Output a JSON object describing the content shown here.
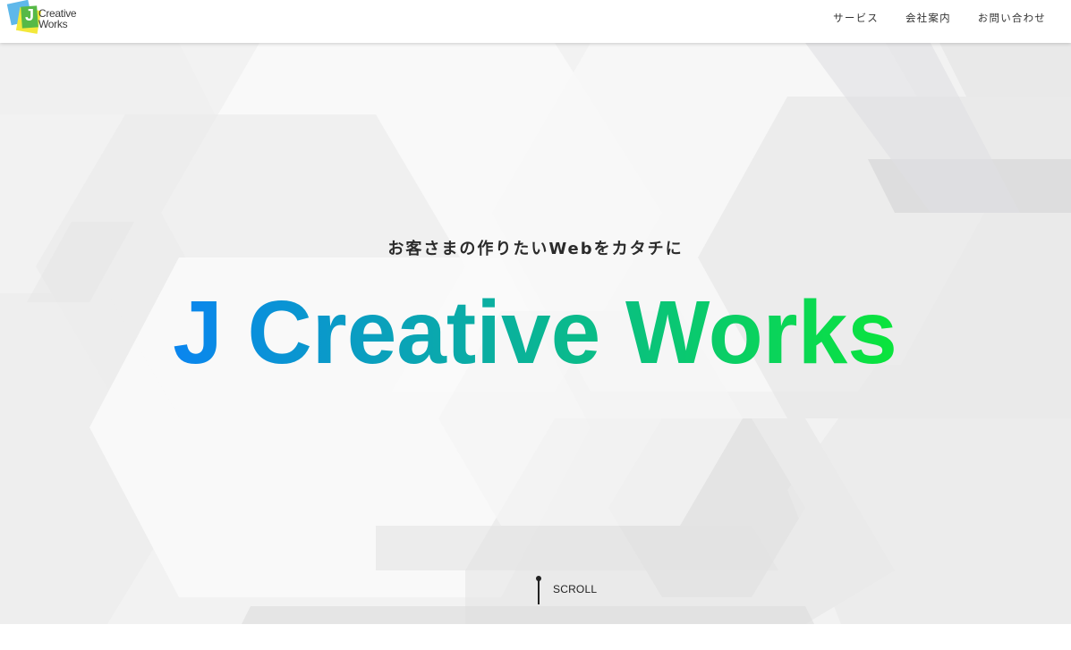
{
  "logo": {
    "mark": "J",
    "line1": "Creative",
    "line2": "Works",
    "icon": "jcw-logo-icon"
  },
  "nav": {
    "items": [
      {
        "label": "サービス"
      },
      {
        "label": "会社案内"
      },
      {
        "label": "お問い合わせ"
      }
    ]
  },
  "hero": {
    "tagline": "お客さまの作りたいWebをカタチに",
    "headline": "J Creative Works",
    "gradient_start": "#0a86ee",
    "gradient_end": "#0ae43c",
    "scroll_label": "SCROLL",
    "scroll_icon": "scroll-indicator-icon"
  },
  "colors": {
    "header_bg": "#ffffff",
    "hero_bg": "#f3f3f3",
    "text": "#2b2b2b"
  }
}
